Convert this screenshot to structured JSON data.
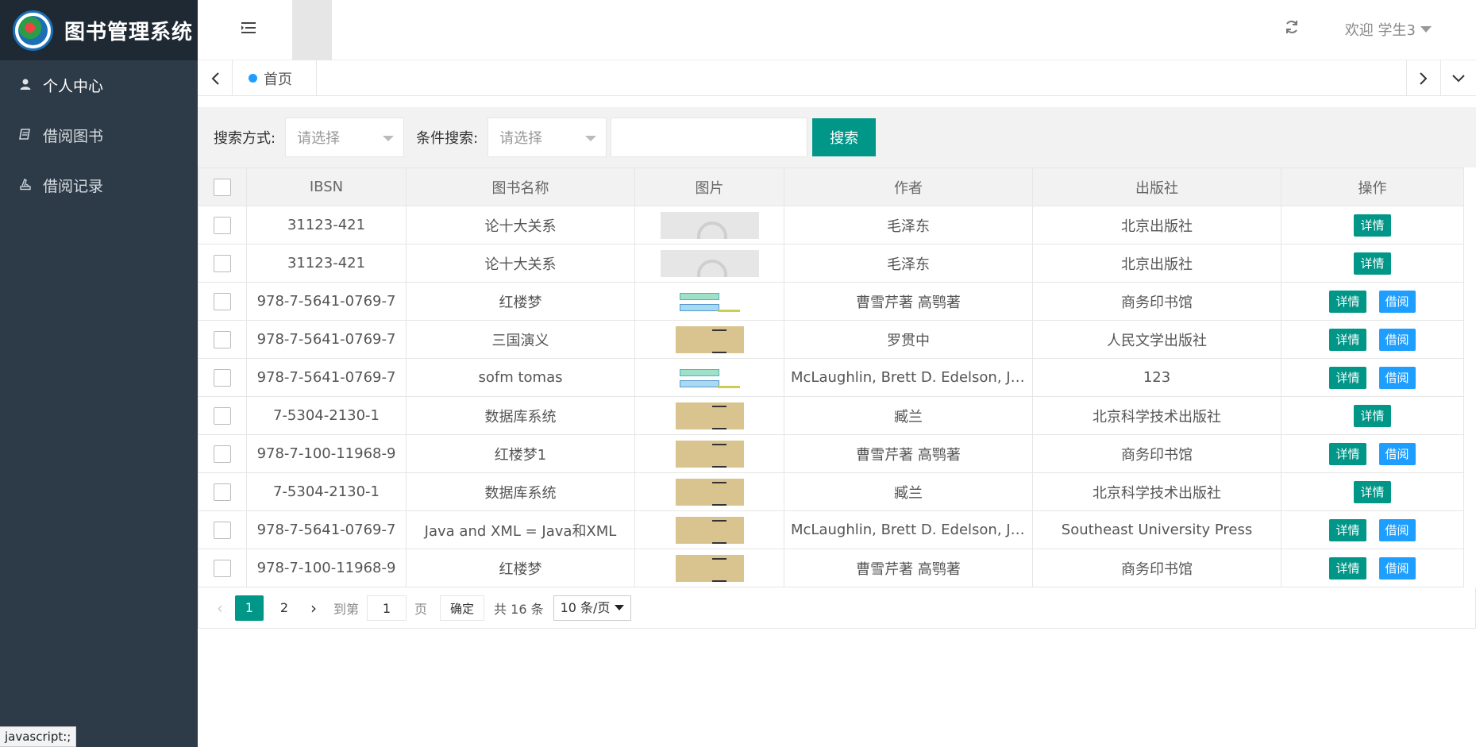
{
  "app": {
    "title": "图书管理系统"
  },
  "sidebar": {
    "items": [
      {
        "label": "个人中心",
        "icon": "user-icon"
      },
      {
        "label": "借阅图书",
        "icon": "book-icon"
      },
      {
        "label": "借阅记录",
        "icon": "record-icon"
      }
    ]
  },
  "header": {
    "welcome": "欢迎 学生3"
  },
  "tabs": {
    "home": "首页"
  },
  "search": {
    "method_label": "搜索方式:",
    "method_placeholder": "请选择",
    "condition_label": "条件搜索:",
    "condition_placeholder": "请选择",
    "keyword_value": "",
    "button": "搜索"
  },
  "table": {
    "headers": [
      "IBSN",
      "图书名称",
      "图片",
      "作者",
      "出版社",
      "操作"
    ],
    "rows": [
      {
        "isbn": "31123-421",
        "name": "论十大关系",
        "author": "毛泽东",
        "publisher": "北京出版社",
        "img": "placeholder",
        "borrow": false
      },
      {
        "isbn": "31123-421",
        "name": "论十大关系",
        "author": "毛泽东",
        "publisher": "北京出版社",
        "img": "placeholder",
        "borrow": false
      },
      {
        "isbn": "978-7-5641-0769-7",
        "name": "红楼梦",
        "author": "曹雪芹著 高鹗著",
        "publisher": "商务印书馆",
        "img": "diagram",
        "borrow": true
      },
      {
        "isbn": "978-7-5641-0769-7",
        "name": "三国演义",
        "author": "罗贯中",
        "publisher": "人民文学出版社",
        "img": "book",
        "borrow": true
      },
      {
        "isbn": "978-7-5641-0769-7",
        "name": "sofm tomas",
        "author": "McLaughlin, Brett D. Edelson, Justin",
        "publisher": "123",
        "img": "diagram",
        "borrow": true
      },
      {
        "isbn": "7-5304-2130-1",
        "name": "数据库系统",
        "author": "臧兰",
        "publisher": "北京科学技术出版社",
        "img": "book",
        "borrow": false
      },
      {
        "isbn": "978-7-100-11968-9",
        "name": "红楼梦1",
        "author": "曹雪芹著 高鹗著",
        "publisher": "商务印书馆",
        "img": "book",
        "borrow": true
      },
      {
        "isbn": "7-5304-2130-1",
        "name": "数据库系统",
        "author": "臧兰",
        "publisher": "北京科学技术出版社",
        "img": "book",
        "borrow": false
      },
      {
        "isbn": "978-7-5641-0769-7",
        "name": "Java and XML = Java和XML",
        "author": "McLaughlin, Brett D. Edelson, Justin",
        "publisher": "Southeast University Press",
        "img": "book",
        "borrow": true
      },
      {
        "isbn": "978-7-100-11968-9",
        "name": "红楼梦",
        "author": "曹雪芹著 高鹗著",
        "publisher": "商务印书馆",
        "img": "book",
        "borrow": true
      }
    ],
    "detail_label": "详情",
    "borrow_label": "借阅"
  },
  "pagination": {
    "pages": [
      "1",
      "2"
    ],
    "current": "1",
    "goto_label": "到第",
    "goto_value": "1",
    "page_unit": "页",
    "confirm": "确定",
    "total": "共 16 条",
    "per_page": "10 条/页"
  },
  "status_tip": "javascript:;"
}
